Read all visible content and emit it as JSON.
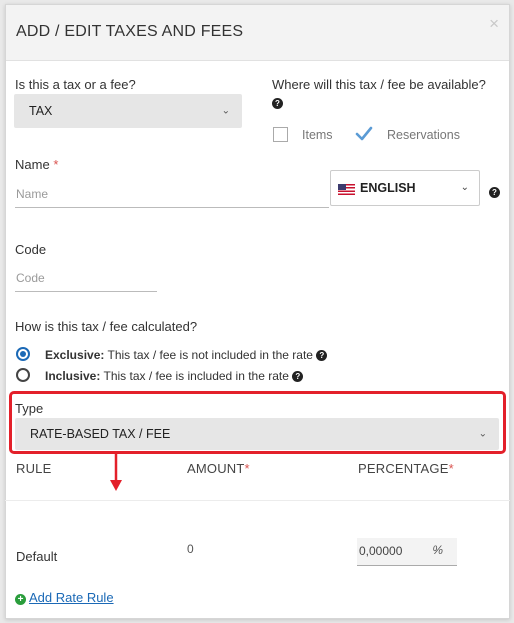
{
  "modal": {
    "title": "ADD / EDIT TAXES AND FEES",
    "close_label": "×"
  },
  "kind": {
    "label": "Is this a tax or a fee?",
    "selected": "TAX"
  },
  "availability": {
    "label": "Where will this tax / fee be available?",
    "items_label": "Items",
    "items_checked": false,
    "reservations_label": "Reservations",
    "reservations_checked": true
  },
  "name": {
    "label": "Name",
    "required_mark": "*",
    "placeholder": "Name",
    "value": ""
  },
  "language": {
    "selected": "ENGLISH",
    "flag": "us-flag-icon"
  },
  "code": {
    "label": "Code",
    "placeholder": "Code",
    "value": ""
  },
  "calculation": {
    "label": "How is this tax / fee calculated?",
    "options": [
      {
        "title": "Exclusive:",
        "description": "This tax / fee is not included in the rate",
        "selected": true
      },
      {
        "title": "Inclusive:",
        "description": "This tax / fee is included in the rate",
        "selected": false
      }
    ]
  },
  "type": {
    "label": "Type",
    "selected": "RATE-BASED TAX / FEE"
  },
  "rules_table": {
    "headers": {
      "rule": "RULE",
      "amount": "AMOUNT",
      "percentage": "PERCENTAGE",
      "required_mark": "*"
    },
    "rows": [
      {
        "rule": "Default",
        "amount": "0",
        "percentage": "0,00000",
        "percent_symbol": "%"
      }
    ]
  },
  "add_rule": {
    "label": "Add Rate Rule"
  },
  "colors": {
    "highlight": "#e3202a",
    "accent": "#1b69b6",
    "add_icon": "#2a9d3c"
  }
}
